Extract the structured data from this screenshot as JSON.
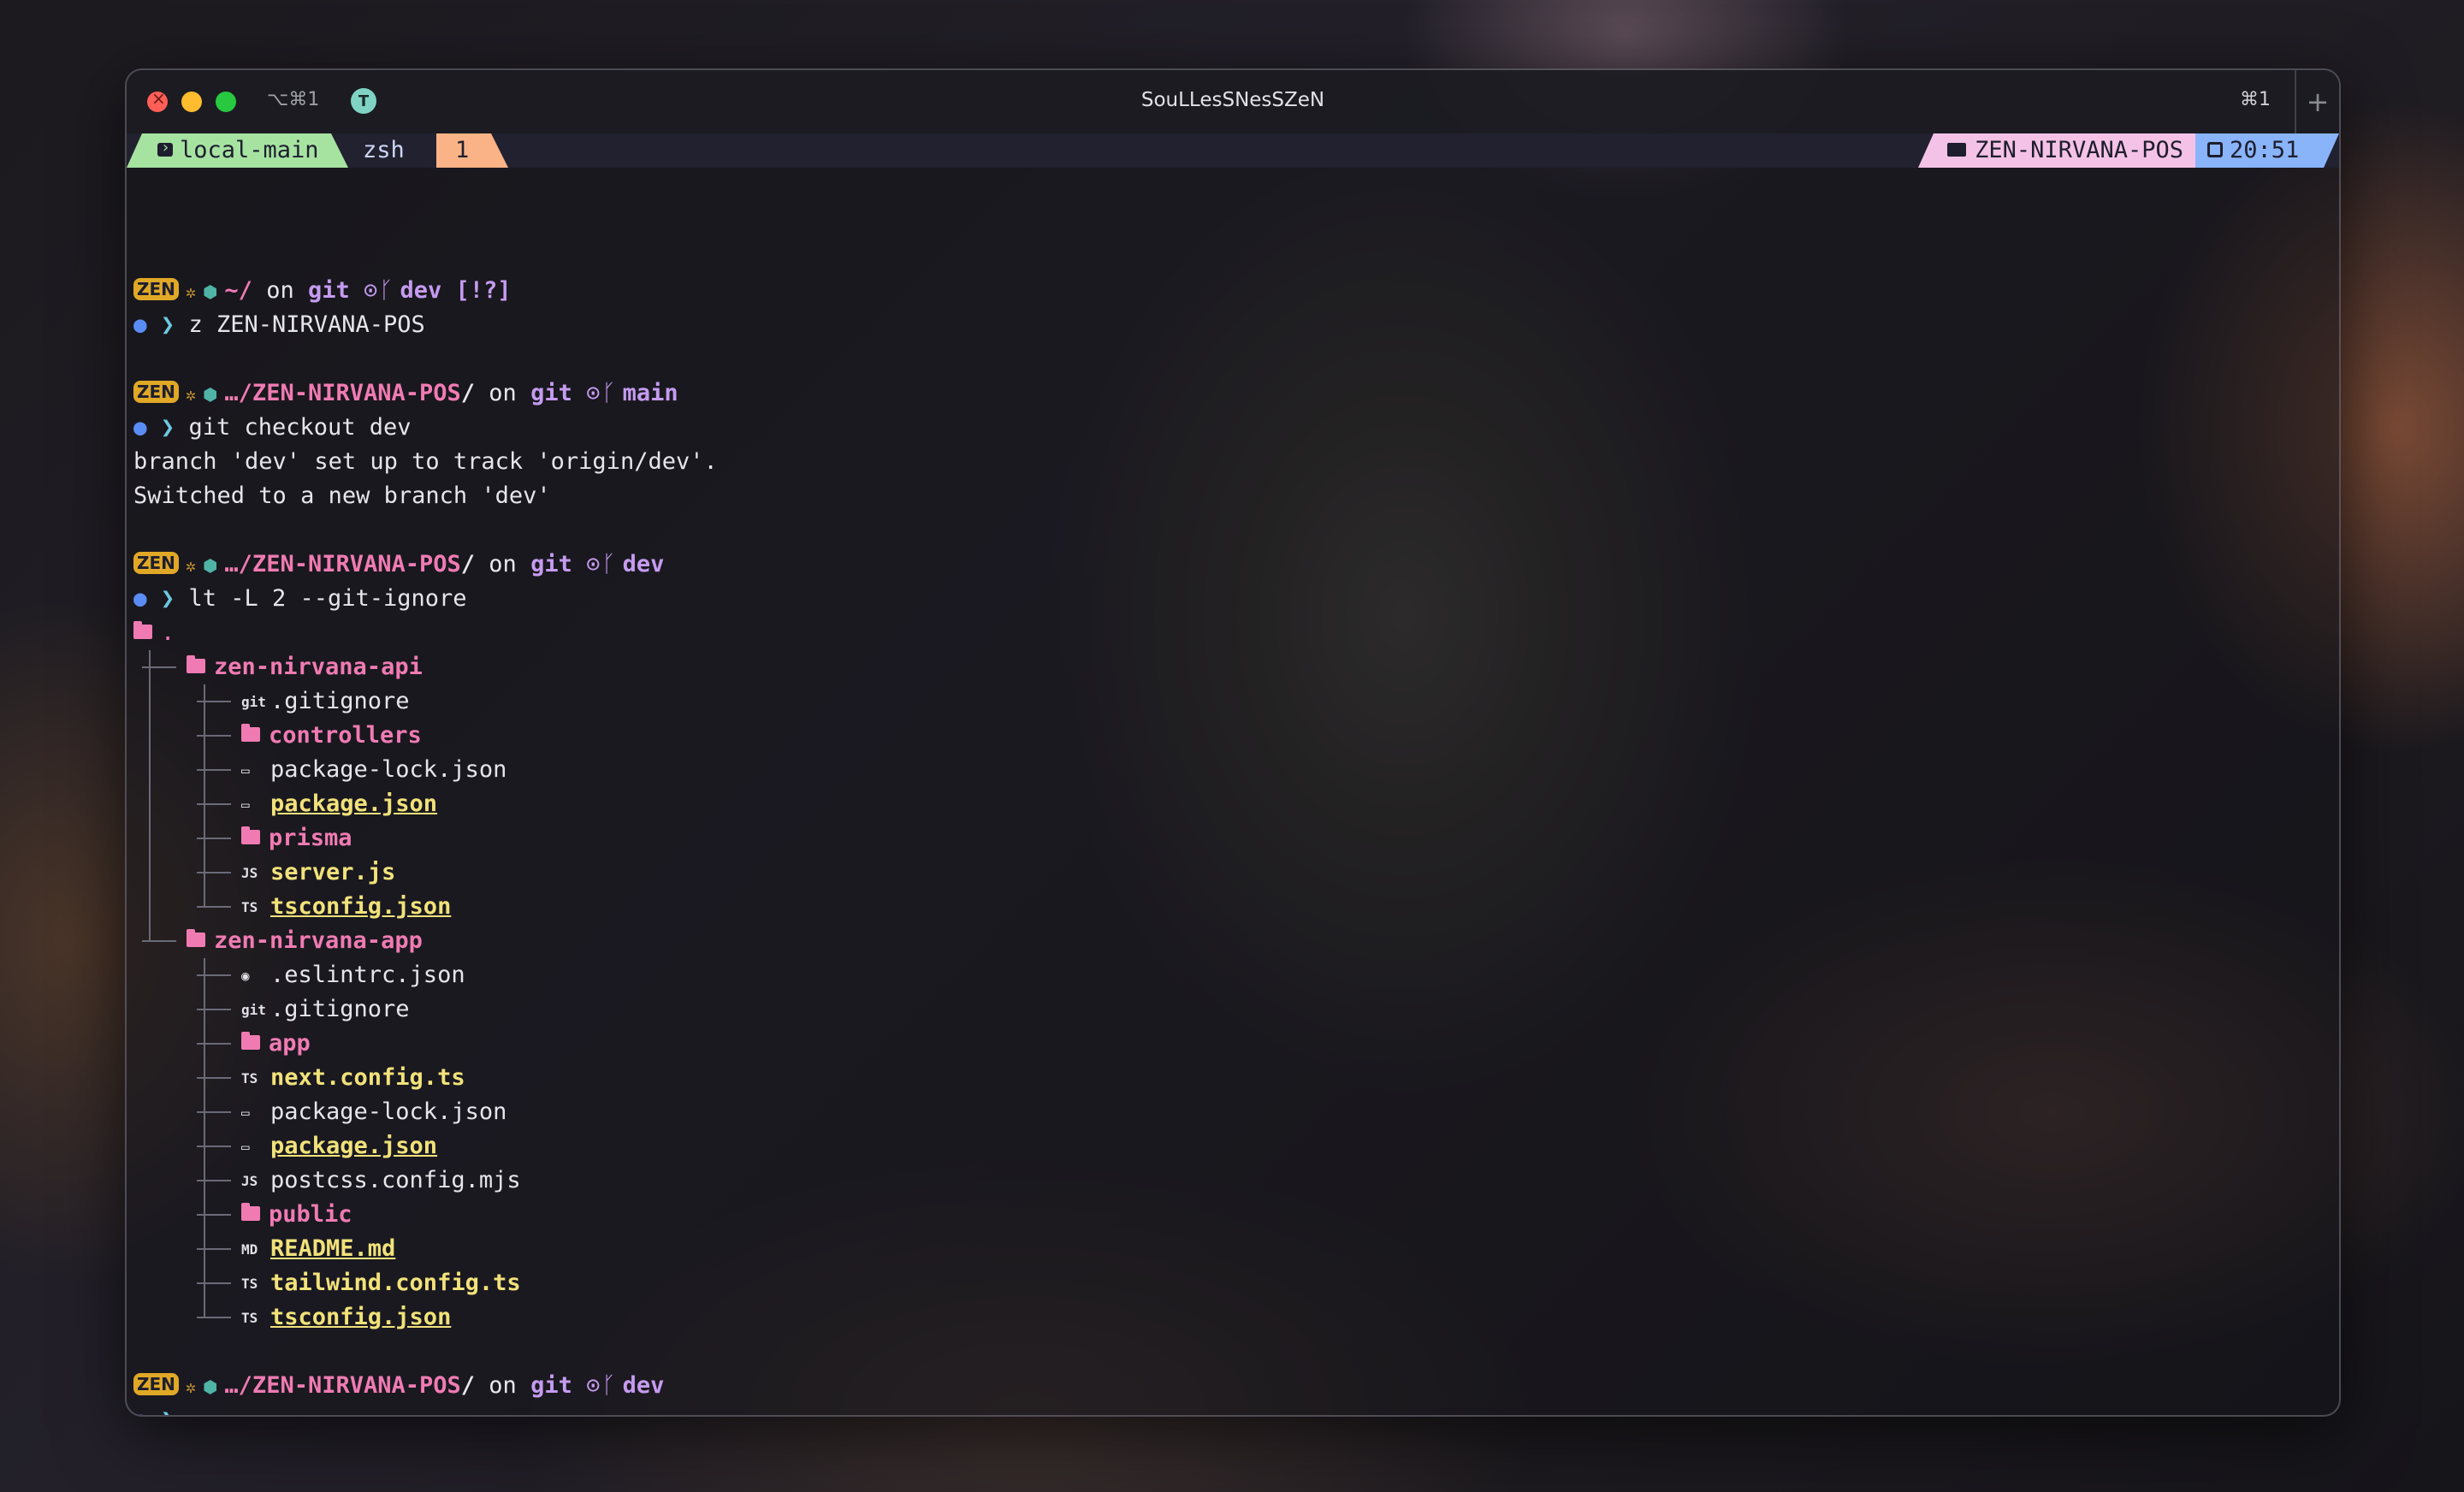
{
  "window": {
    "title": "SouLLesSNesSZeN",
    "shortcut_left": "⌥⌘1",
    "badge": "T",
    "shortcut_right": "⌘1",
    "new_tab": "+"
  },
  "tmux": {
    "session": "local-main",
    "window_name": "zsh",
    "window_index": "1",
    "directory": "ZEN-NIRVANA-POS",
    "time": "20:51"
  },
  "prompts": [
    {
      "badge": "ZEN",
      "path": "~/",
      "on": "on",
      "git": "git",
      "branch": "dev",
      "status": "[!?]",
      "command": "z ZEN-NIRVANA-POS"
    },
    {
      "badge": "ZEN",
      "path": "…/ZEN-NIRVANA-POS",
      "path_suffix": "/",
      "on": "on",
      "git": "git",
      "branch": "main",
      "command": "git checkout dev"
    },
    {
      "badge": "ZEN",
      "path": "…/ZEN-NIRVANA-POS",
      "path_suffix": "/",
      "on": "on",
      "git": "git",
      "branch": "dev",
      "command": "lt -L 2 --git-ignore"
    },
    {
      "badge": "ZEN",
      "path": "…/ZEN-NIRVANA-POS",
      "path_suffix": "/",
      "on": "on",
      "git": "git",
      "branch": "dev",
      "command": ""
    }
  ],
  "checkout_output": [
    "branch 'dev' set up to track 'origin/dev'.",
    "Switched to a new branch 'dev'"
  ],
  "tree": {
    "root": ".",
    "dirs": [
      {
        "name": "zen-nirvana-api",
        "files": [
          {
            "icon": "git",
            "name": ".gitignore"
          },
          {
            "icon": "folder",
            "name": "controllers"
          },
          {
            "icon": "json",
            "name": "package-lock.json"
          },
          {
            "icon": "json",
            "name": "package.json"
          },
          {
            "icon": "folder",
            "name": "prisma"
          },
          {
            "icon": "JS",
            "name": "server.js"
          },
          {
            "icon": "TS",
            "name": "tsconfig.json"
          }
        ]
      },
      {
        "name": "zen-nirvana-app",
        "files": [
          {
            "icon": "eslint",
            "name": ".eslintrc.json"
          },
          {
            "icon": "git",
            "name": ".gitignore"
          },
          {
            "icon": "folder",
            "name": "app"
          },
          {
            "icon": "TS",
            "name": "next.config.ts"
          },
          {
            "icon": "json",
            "name": "package-lock.json"
          },
          {
            "icon": "json",
            "name": "package.json"
          },
          {
            "icon": "JS",
            "name": "postcss.config.mjs"
          },
          {
            "icon": "folder",
            "name": "public"
          },
          {
            "icon": "MD",
            "name": "README.md"
          },
          {
            "icon": "TS",
            "name": "tailwind.config.ts"
          },
          {
            "icon": "TS",
            "name": "tsconfig.json"
          }
        ]
      }
    ]
  },
  "colors": {
    "session_bg": "#a6e3a1",
    "index_bg": "#fab387",
    "dir_bg": "#f5c2e7",
    "time_bg": "#89b4fa",
    "path_pink": "#f07bb3",
    "git_purple": "#c59bf0",
    "file_yellow": "#f1e27a"
  }
}
